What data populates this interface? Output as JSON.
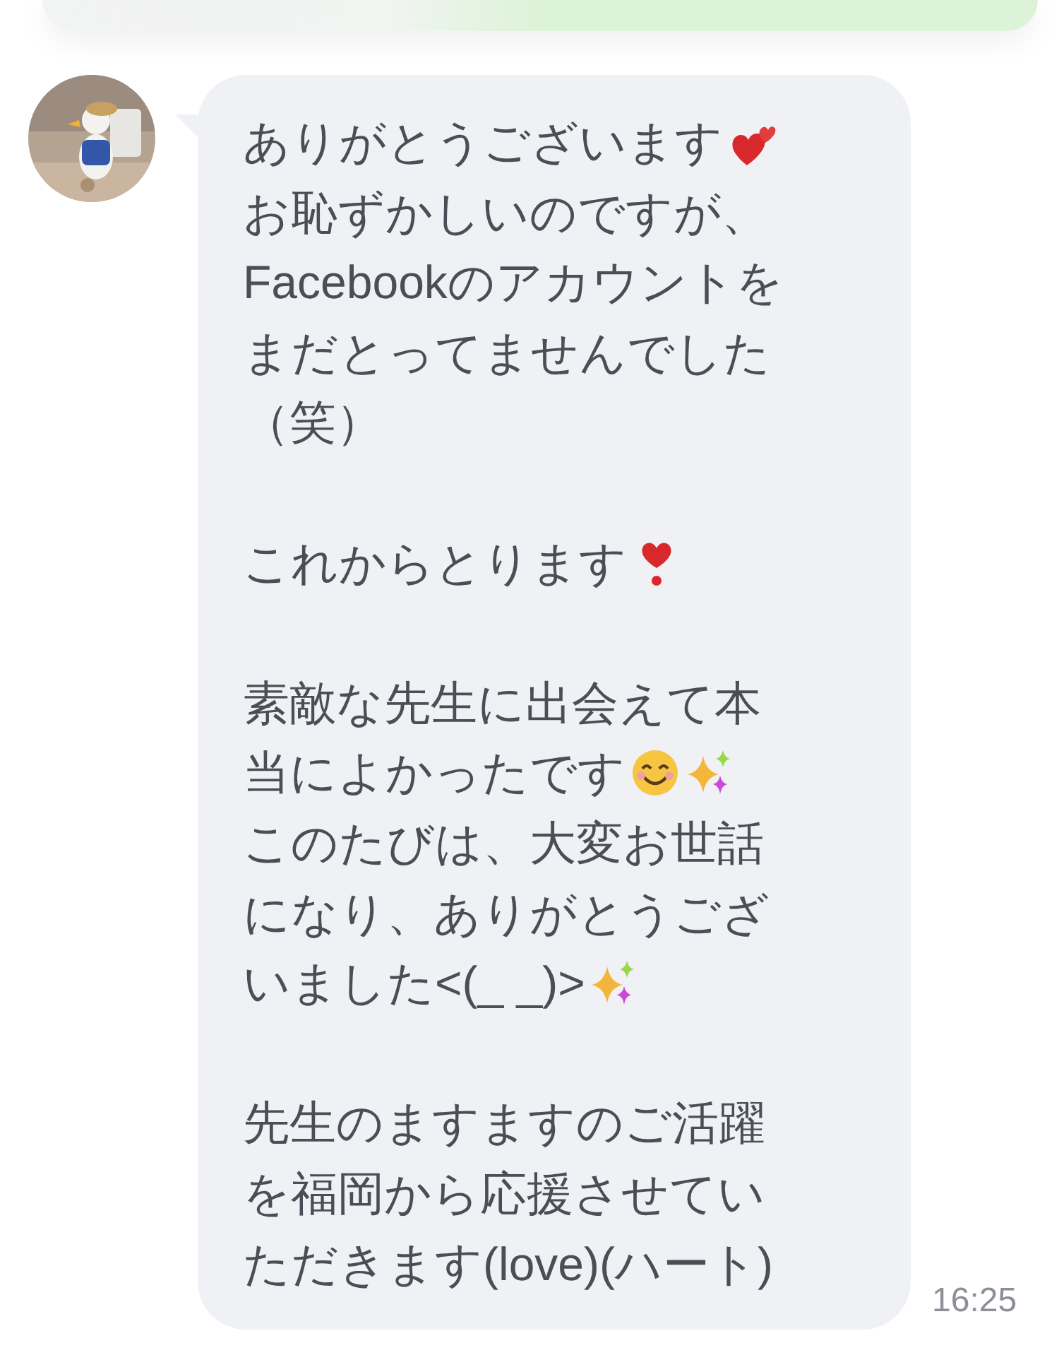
{
  "previous_message": {
    "kind": "sent"
  },
  "message": {
    "kind": "received",
    "time": "16:25",
    "paragraphs": [
      [
        [
          {
            "kind": "text",
            "text": "ありがとうございます"
          },
          {
            "kind": "hearts"
          }
        ],
        [
          {
            "kind": "text",
            "text": "お恥ずかしいのですが、"
          }
        ],
        [
          {
            "kind": "text",
            "text": "Facebookのアカウントを"
          }
        ],
        [
          {
            "kind": "text",
            "text": "まだとってませんでした"
          }
        ],
        [
          {
            "kind": "text",
            "text": "（笑）"
          }
        ]
      ],
      [
        [
          {
            "kind": "text",
            "text": "これからとります"
          },
          {
            "kind": "heart"
          }
        ]
      ],
      [
        [
          {
            "kind": "text",
            "text": "素敵な先生に出会えて本"
          }
        ],
        [
          {
            "kind": "text",
            "text": "当によかったです"
          },
          {
            "kind": "smiley"
          },
          {
            "kind": "sparkles"
          }
        ],
        [
          {
            "kind": "text",
            "text": "このたびは、大変お世話"
          }
        ],
        [
          {
            "kind": "text",
            "text": "になり、ありがとうござ"
          }
        ],
        [
          {
            "kind": "text",
            "text": "いました<(_ _)>"
          },
          {
            "kind": "sparkles"
          }
        ]
      ],
      [
        [
          {
            "kind": "text",
            "text": "先生のますますのご活躍"
          }
        ],
        [
          {
            "kind": "text",
            "text": "を福岡から応援させてい"
          }
        ],
        [
          {
            "kind": "text",
            "text": "ただきます(love)(ハート)"
          }
        ]
      ]
    ]
  }
}
